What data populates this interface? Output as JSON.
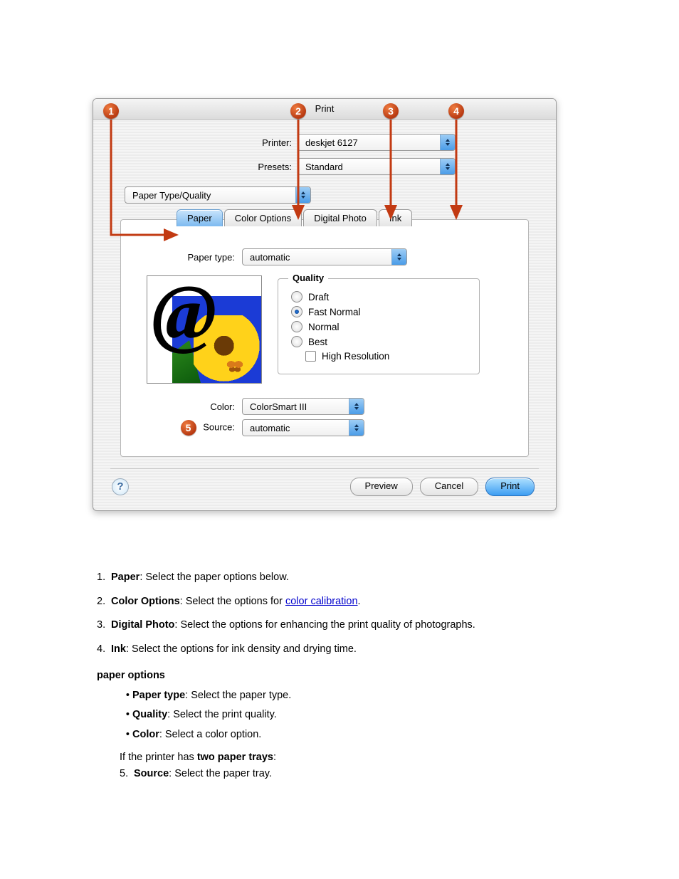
{
  "dialog": {
    "title": "Print",
    "printer_label": "Printer:",
    "printer_value": "deskjet 6127",
    "presets_label": "Presets:",
    "presets_value": "Standard",
    "section_value": "Paper Type/Quality",
    "tabs": {
      "paper": "Paper",
      "color": "Color Options",
      "digital": "Digital Photo",
      "ink": "Ink"
    },
    "paper_type_label": "Paper type:",
    "paper_type_value": "automatic",
    "quality": {
      "legend": "Quality",
      "draft": "Draft",
      "fast_normal": "Fast Normal",
      "normal": "Normal",
      "best": "Best",
      "high_res": "High Resolution"
    },
    "color_label": "Color:",
    "color_value": "ColorSmart III",
    "source_label": "Source:",
    "source_value": "automatic",
    "preview_btn": "Preview",
    "cancel_btn": "Cancel",
    "print_btn": "Print"
  },
  "markers": {
    "m1": "1",
    "m2": "2",
    "m3": "3",
    "m4": "4",
    "m5": "5"
  },
  "doc": {
    "l1a": "1. ",
    "l1b": "Paper",
    "l1c": ": Select the paper options below.",
    "l2a": "2. ",
    "l2b": "Color Options",
    "l2c": ": Select the options for ",
    "l2link": "color calibration",
    "l2d": ".",
    "l3a": "3. ",
    "l3b": "Digital Photo",
    "l3c": ": Select the options for enhancing the print quality of photographs.",
    "l4a": "4. ",
    "l4b": "Ink",
    "l4c": ": Select the options for ink density and drying time.",
    "p_options": "paper options",
    "opt1a": "Paper type",
    "opt1b": ": Select the paper type.",
    "opt2a": "Quality",
    "opt2b": ": Select the print quality.",
    "opt3a": "Color",
    "opt3b": ": Select a color option.",
    "note_intro": "If the printer has ",
    "note_bold": "two paper trays",
    "note_colon": ":",
    "l5a": "5. ",
    "l5b": "Source",
    "l5c": ": Select the paper tray."
  }
}
